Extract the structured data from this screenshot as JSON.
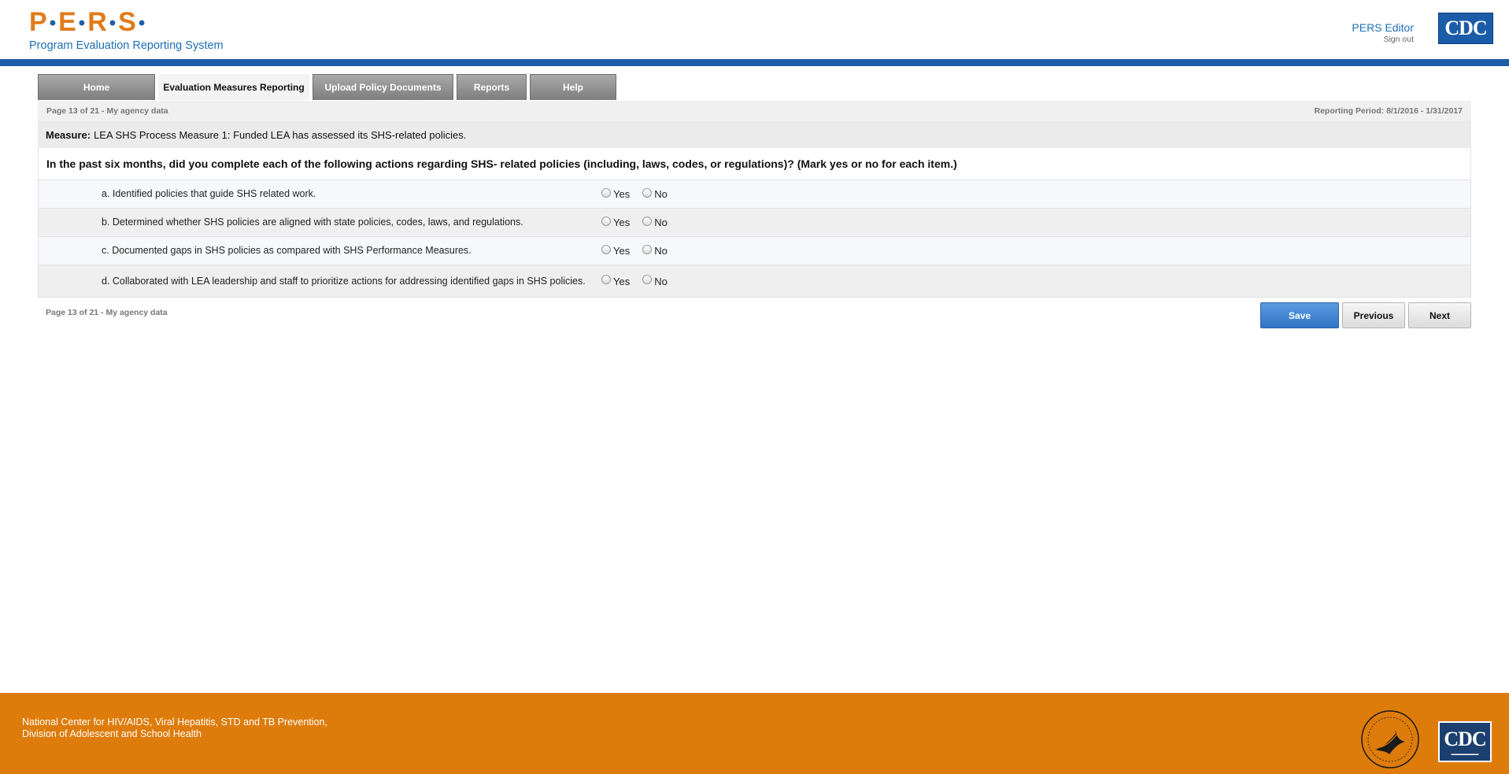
{
  "header": {
    "logo_letters": [
      "P",
      "E",
      "R",
      "S"
    ],
    "logo_subtitle": "Program Evaluation Reporting System",
    "user_name": "PERS Editor",
    "signout_label": "Sign out",
    "cdc_logo": "CDC"
  },
  "tabs": [
    {
      "label": "Home",
      "active": false
    },
    {
      "label": "Evaluation Measures Reporting",
      "active": true
    },
    {
      "label": "Upload Policy Documents",
      "active": false
    },
    {
      "label": "Reports",
      "active": false
    },
    {
      "label": "Help",
      "active": false
    }
  ],
  "form": {
    "page_info": "Page 13 of 21 - My agency data",
    "reporting_period": "Reporting Period: 8/1/2016 - 1/31/2017",
    "measure_label": "Measure:",
    "measure_text": "LEA SHS Process Measure 1: Funded LEA has assessed its SHS-related policies.",
    "question": "In the past six months, did you complete each of the following actions regarding SHS- related policies (including, laws, codes, or regulations)? (Mark yes or no for each item.)",
    "yes_label": "Yes",
    "no_label": "No",
    "items": [
      {
        "text": "a. Identified policies that guide SHS related work."
      },
      {
        "text": "b. Determined whether SHS policies are aligned with state policies, codes, laws, and regulations."
      },
      {
        "text": "c. Documented gaps in SHS policies as compared with SHS Performance Measures."
      },
      {
        "text": "d. Collaborated with LEA leadership and staff to prioritize actions for addressing identified gaps in SHS policies."
      }
    ],
    "footer_page_info": "Page 13 of 21 - My agency data",
    "buttons": {
      "save": "Save",
      "previous": "Previous",
      "next": "Next"
    }
  },
  "footer": {
    "line1": "National Center for HIV/AIDS, Viral Hepatitis, STD and TB Prevention,",
    "line2": "Division of Adolescent and School Health",
    "cdc_logo": "CDC"
  },
  "colors": {
    "brand_orange": "#de7c0b",
    "brand_blue": "#1c5da8",
    "save_blue": "#2f74c6"
  }
}
